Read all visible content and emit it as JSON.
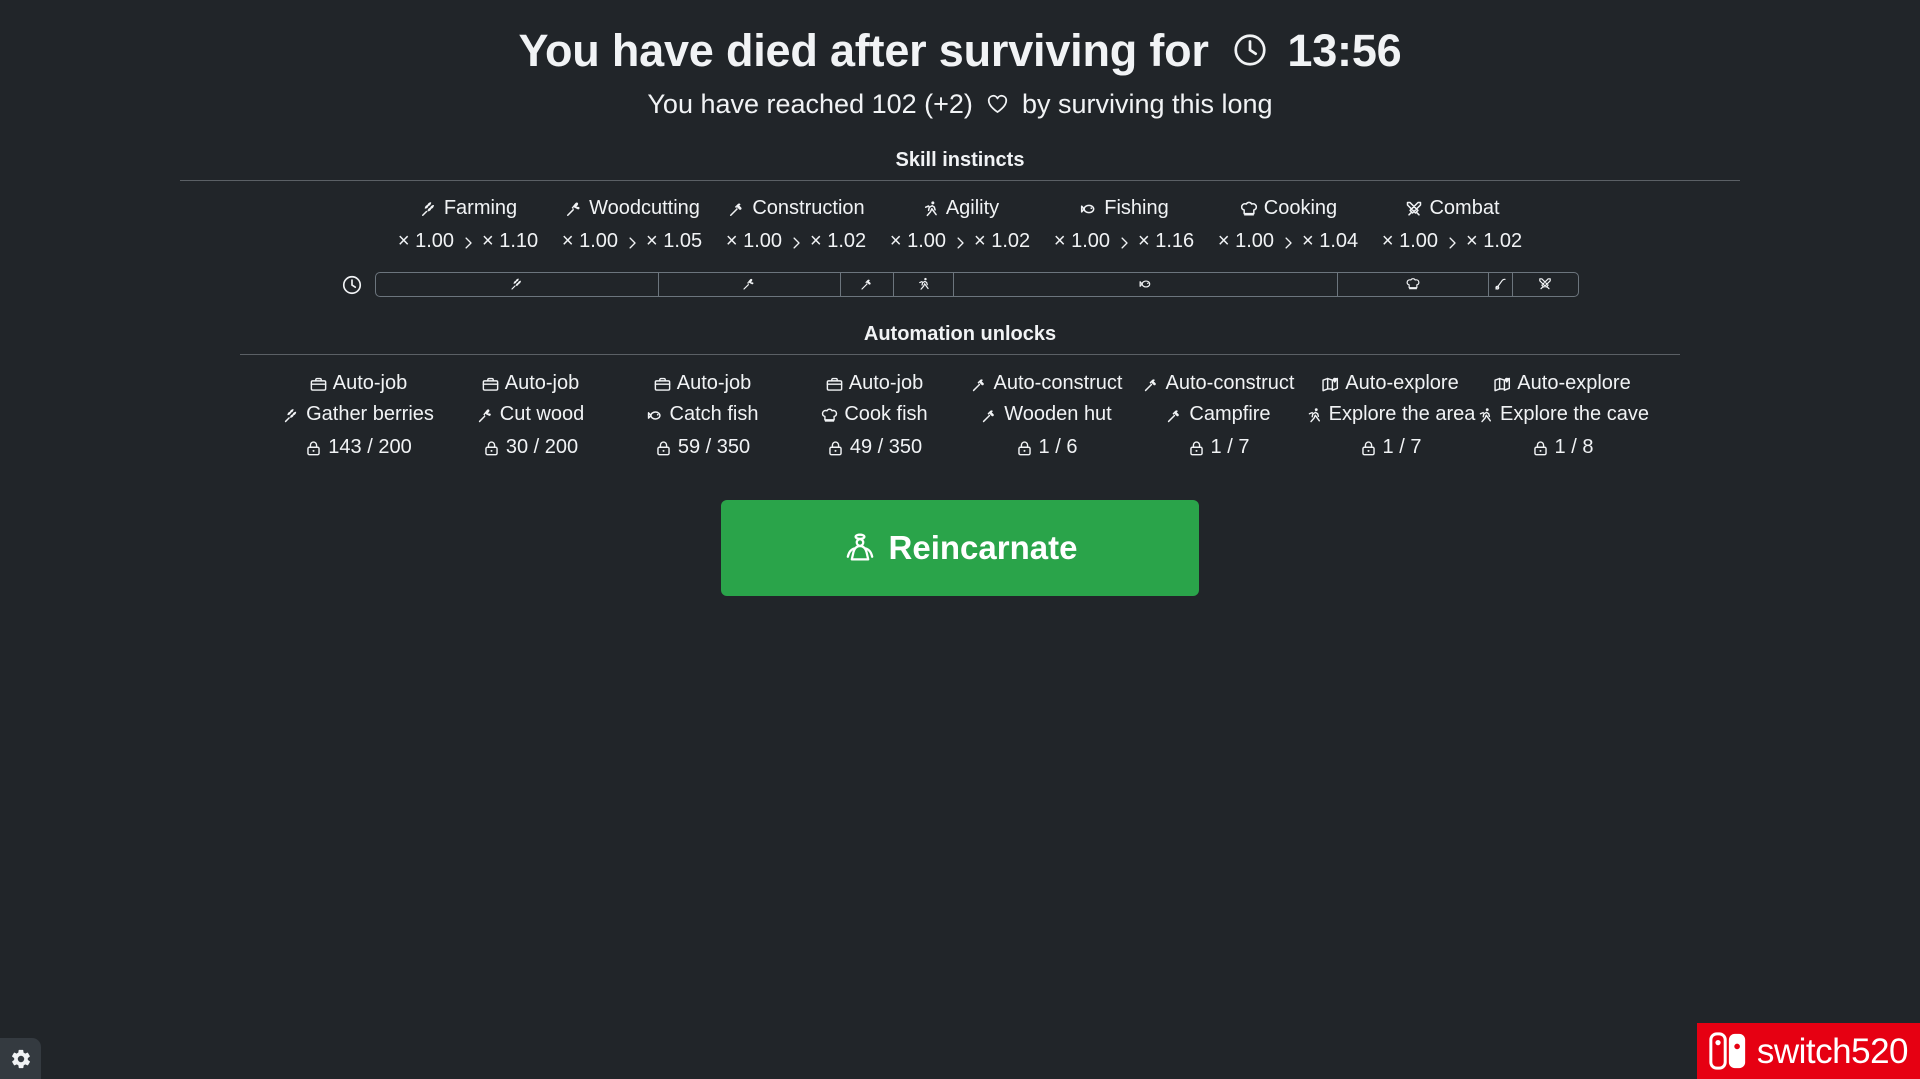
{
  "header": {
    "title_prefix": "You have died after surviving for",
    "clock_icon": "clock-icon",
    "survival_time": "13:56",
    "subtitle_prefix": "You have reached 102 (+2)",
    "heart_icon": "heart-icon",
    "subtitle_suffix": "by surviving this long"
  },
  "skill_instincts": {
    "title": "Skill instincts",
    "skills": [
      {
        "name": "Farming",
        "icon": "wheat-icon",
        "from": "× 1.00",
        "to": "× 1.10"
      },
      {
        "name": "Woodcutting",
        "icon": "axe-icon",
        "from": "× 1.00",
        "to": "× 1.05"
      },
      {
        "name": "Construction",
        "icon": "hammer-icon",
        "from": "× 1.00",
        "to": "× 1.02"
      },
      {
        "name": "Agility",
        "icon": "running-icon",
        "from": "× 1.00",
        "to": "× 1.02"
      },
      {
        "name": "Fishing",
        "icon": "fish-icon",
        "from": "× 1.00",
        "to": "× 1.16"
      },
      {
        "name": "Cooking",
        "icon": "chef-hat-icon",
        "from": "× 1.00",
        "to": "× 1.04"
      },
      {
        "name": "Combat",
        "icon": "crossed-swords-icon",
        "from": "× 1.00",
        "to": "× 1.02"
      }
    ]
  },
  "timeline": {
    "clock_icon": "clock-icon",
    "segments": [
      {
        "icon": "wheat-icon",
        "flex": 225
      },
      {
        "icon": "axe-icon",
        "flex": 144
      },
      {
        "icon": "hammer-icon",
        "flex": 42
      },
      {
        "icon": "running-icon",
        "flex": 47
      },
      {
        "icon": "fish-icon",
        "flex": 305
      },
      {
        "icon": "chef-hat-icon",
        "flex": 120
      },
      {
        "icon": "fishing-rod-icon",
        "flex": 18
      },
      {
        "icon": "crossed-swords-icon",
        "flex": 52
      }
    ]
  },
  "automation_unlocks": {
    "title": "Automation unlocks",
    "items": [
      {
        "type": "Auto-job",
        "type_icon": "briefcase-icon",
        "target": "Gather berries",
        "target_icon": "wheat-icon",
        "progress": "143 / 200",
        "lock_icon": "lock-icon"
      },
      {
        "type": "Auto-job",
        "type_icon": "briefcase-icon",
        "target": "Cut wood",
        "target_icon": "axe-icon",
        "progress": "30 / 200",
        "lock_icon": "lock-icon"
      },
      {
        "type": "Auto-job",
        "type_icon": "briefcase-icon",
        "target": "Catch fish",
        "target_icon": "fish-icon",
        "progress": "59 / 350",
        "lock_icon": "lock-icon"
      },
      {
        "type": "Auto-job",
        "type_icon": "briefcase-icon",
        "target": "Cook fish",
        "target_icon": "chef-hat-icon",
        "progress": "49 / 350",
        "lock_icon": "lock-icon"
      },
      {
        "type": "Auto-construct",
        "type_icon": "hammer-icon",
        "target": "Wooden hut",
        "target_icon": "hammer-icon",
        "progress": "1 / 6",
        "lock_icon": "lock-icon"
      },
      {
        "type": "Auto-construct",
        "type_icon": "hammer-icon",
        "target": "Campfire",
        "target_icon": "hammer-icon",
        "progress": "1 / 7",
        "lock_icon": "lock-icon"
      },
      {
        "type": "Auto-explore",
        "type_icon": "map-icon",
        "target": "Explore the area",
        "target_icon": "running-icon",
        "progress": "1 / 7",
        "lock_icon": "lock-icon"
      },
      {
        "type": "Auto-explore",
        "type_icon": "map-icon",
        "target": "Explore the cave",
        "target_icon": "running-icon",
        "progress": "1 / 8",
        "lock_icon": "lock-icon"
      }
    ]
  },
  "reincarnate": {
    "label": "Reincarnate",
    "icon": "reincarnate-angel-icon",
    "color": "#2aa44a"
  },
  "settings": {
    "icon": "gear-icon"
  },
  "watermark": {
    "text": "switch520",
    "icon": "nintendo-switch-icon",
    "color": "#e60012"
  }
}
